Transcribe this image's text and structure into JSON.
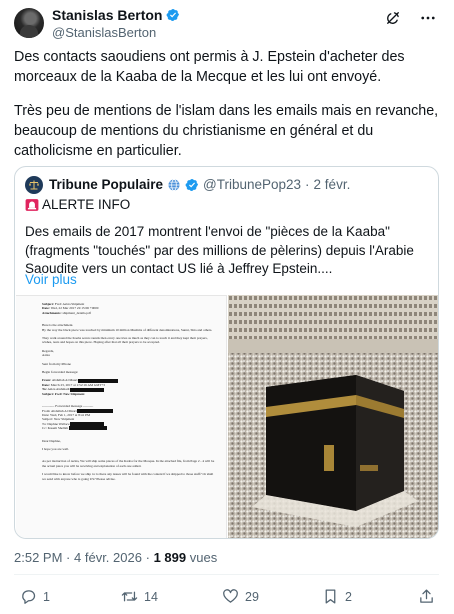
{
  "author": {
    "name": "Stanislas Berton",
    "handle": "@StanislasBerton"
  },
  "tweet": {
    "paragraph1": "Des contacts saoudiens ont permis à J. Epstein d'acheter des morceaux de la Kaaba de la Mecque et les lui ont envoyé.",
    "paragraph2": "Très peu de mentions de l'islam dans les emails mais en revanche, beaucoup de mentions du christianisme en général et du catholicisme en particulier."
  },
  "quote": {
    "name": "Tribune Populaire",
    "flag": "🇺🇳",
    "handle": "@TribunePop23",
    "separator": "·",
    "date": "2 févr.",
    "alert": "ALERTE INFO",
    "text": "Des emails de 2017 montrent l'envoi de \"pièces de la Kaaba\" (fragments \"touchés\" par des millions de pèlerins) depuis l'Arabie Saoudite vers un contact US lié à Jeffrey Epstein....",
    "see_more": "Voir plus",
    "document": {
      "subject_label": "Subject:",
      "subject": "Fwd: Aziza Shipment",
      "date_label": "Date:",
      "date": "Wed, 22 Mar 2017 22:15:06 +0000",
      "attachments_label": "Attachments:",
      "attachments": "shipment_details.pdf",
      "line1": "Here is the attachment.",
      "line2": "By the way the black piece was touched by minimum 10 million Muslims of different denominations, Sunni, Shia and others.",
      "line3": "They walk around the Kaaba seven rounds then every one tries as much as they can to touch it and they kept their prayers, wishes, tears and hopes on this piece. Hoping after that all their prayers to be accepted.",
      "regards": "Regards,",
      "signer": "Aziza",
      "sent_from": "Sent from my iPhone",
      "begin_fwd": "Begin forwarded message:",
      "from1_label": "From:",
      "from1": "Abdullah Al Maari",
      "date1_label": "Date:",
      "date1": "March 23, 2017 at 1:52:16 AM GMT+3",
      "to1_label": "To:",
      "to1": "Aziza Alahmadi",
      "subj1_label": "Subject:",
      "subj1": "Fwd: New Shipment",
      "fwd_marker": "----------- Forwarded message ---------",
      "from2_label": "From:",
      "from2": "Abdullah Al Maari",
      "date2_label": "Date:",
      "date2": "Wed, Feb 1, 2017 at 8:41 PM",
      "subj2_label": "Subject:",
      "subj2": "New Shipment",
      "to2_label": "To:",
      "to2": "Daphne Wallace",
      "cc2_label": "Cc:",
      "cc2": "Kasem Shellah",
      "dear": "Dear Daphne,",
      "hope": "I hope you are well.",
      "instruction": "As per instruction of Aziza, We will ship some pieces of the Kaaba for the Mosque. In the attached file, from Page 2 - 4 will be the actual piece you will be receiving and explanation of each one added.",
      "closing": "I would like to know before we ship to: is there any issues will be found with the content if we shipped to those stuff? Or shall we send with anyone who is going US? Please advise."
    }
  },
  "footer": {
    "time": "2:52 PM",
    "dot1": "·",
    "date": "4 févr. 2026",
    "dot2": "·",
    "views_count": "1 899",
    "views_label": "vues"
  },
  "actions": {
    "replies": "1",
    "reposts": "14",
    "likes": "29",
    "bookmarks": "2"
  },
  "colors": {
    "accent": "#1d9bf0",
    "muted": "#536471",
    "text": "#0f1419",
    "border": "#cfd9de"
  },
  "icons": [
    "verified-badge-icon",
    "grok-icon",
    "more-icon",
    "globe-icon",
    "alert-siren-icon",
    "reply-icon",
    "repost-icon",
    "like-icon",
    "bookmark-icon",
    "share-icon"
  ]
}
